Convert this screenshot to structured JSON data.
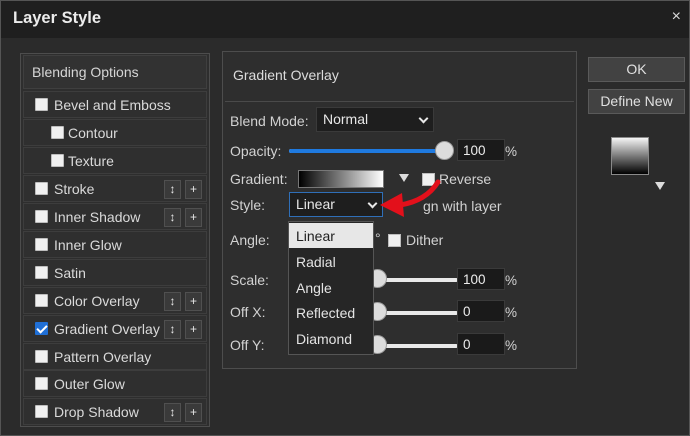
{
  "window": {
    "title": "Layer Style",
    "close_glyph": "×"
  },
  "left_panel": {
    "blending_options": "Blending Options",
    "items": [
      {
        "label": "Bevel and Emboss",
        "checked": false,
        "indent": false,
        "has_buttons": false
      },
      {
        "label": "Contour",
        "checked": false,
        "indent": true,
        "has_buttons": false
      },
      {
        "label": "Texture",
        "checked": false,
        "indent": true,
        "has_buttons": false
      },
      {
        "label": "Stroke",
        "checked": false,
        "indent": false,
        "has_buttons": true
      },
      {
        "label": "Inner Shadow",
        "checked": false,
        "indent": false,
        "has_buttons": true
      },
      {
        "label": "Inner Glow",
        "checked": false,
        "indent": false,
        "has_buttons": false
      },
      {
        "label": "Satin",
        "checked": false,
        "indent": false,
        "has_buttons": false
      },
      {
        "label": "Color Overlay",
        "checked": false,
        "indent": false,
        "has_buttons": true
      },
      {
        "label": "Gradient Overlay",
        "checked": true,
        "indent": false,
        "has_buttons": true
      },
      {
        "label": "Pattern Overlay",
        "checked": false,
        "indent": false,
        "has_buttons": false
      },
      {
        "label": "Outer Glow",
        "checked": false,
        "indent": false,
        "has_buttons": false
      },
      {
        "label": "Drop Shadow",
        "checked": false,
        "indent": false,
        "has_buttons": true
      }
    ],
    "button_up_glyph": "↕",
    "button_plus_glyph": "+"
  },
  "gradient_overlay": {
    "section_title": "Gradient Overlay",
    "blend_mode_label": "Blend Mode:",
    "blend_mode_value": "Normal",
    "opacity_label": "Opacity:",
    "opacity_value": "100",
    "opacity_fraction": 1.0,
    "percent": "%",
    "gradient_label": "Gradient:",
    "reverse_label": "Reverse",
    "reverse_visible": "R",
    "reverse_rest": "everse",
    "style_label": "Style:",
    "style_value": "Linear",
    "align_partial": "gn with layer",
    "angle_label": "Angle:",
    "angle_symbol": "°",
    "dither_label": "Dither",
    "scale_label": "Scale:",
    "scale_value": "100",
    "offx_label": "Off X:",
    "offx_value": "0",
    "offy_label": "Off Y:",
    "offy_value": "0"
  },
  "style_dropdown": {
    "options": [
      "Linear",
      "Radial",
      "Angle",
      "Reflected",
      "Diamond"
    ],
    "selected": "Linear"
  },
  "right_column": {
    "ok_label": "OK",
    "define_new_label": "Define New"
  },
  "colors": {
    "dialog_bg": "#2b2b2b",
    "accent_blue": "#1f7ae0",
    "annotation_red": "#e3101b"
  }
}
